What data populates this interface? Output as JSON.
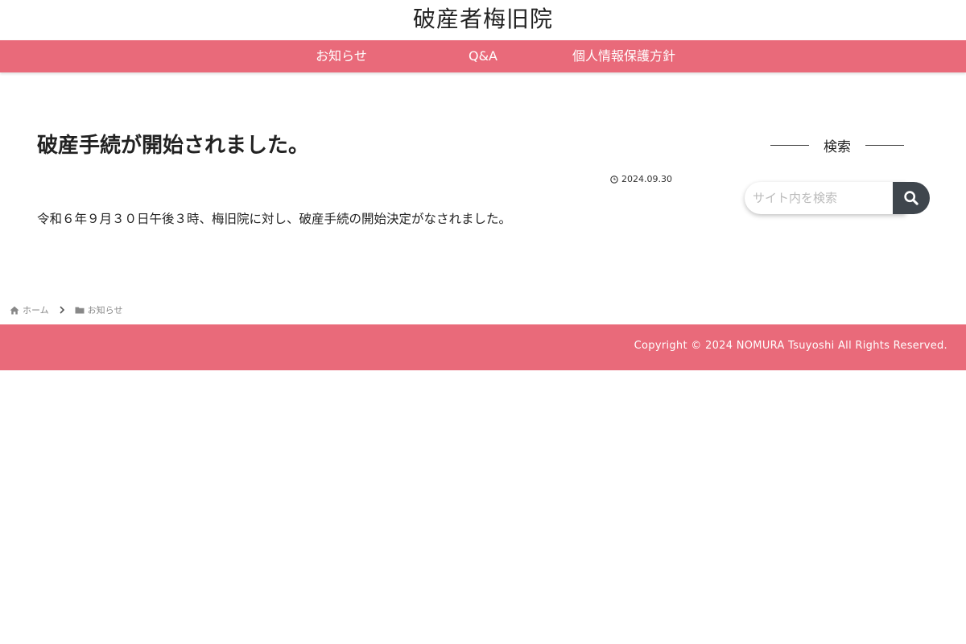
{
  "site": {
    "title": "破産者梅旧院"
  },
  "nav": {
    "items": [
      {
        "label": "お知らせ"
      },
      {
        "label": "Q&A"
      },
      {
        "label": "個人情報保護方針"
      }
    ]
  },
  "post": {
    "title": "破産手続が開始されました。",
    "date": "2024.09.30",
    "body": "令和６年９月３０日午後３時、梅旧院に対し、破産手続の開始決定がなされました。"
  },
  "sidebar": {
    "search_title": "検索",
    "search_placeholder": "サイト内を検索"
  },
  "breadcrumb": {
    "home": "ホーム",
    "category": "お知らせ"
  },
  "footer": {
    "copyright": "Copyright © 2024 NOMURA Tsuyoshi All Rights Reserved."
  },
  "colors": {
    "accent": "#e96a7a",
    "search_button": "#3f464d"
  },
  "icons": {
    "date": "clock-icon",
    "search": "search-icon",
    "home": "home-icon",
    "separator": "chevron-right-icon",
    "category": "folder-icon"
  }
}
